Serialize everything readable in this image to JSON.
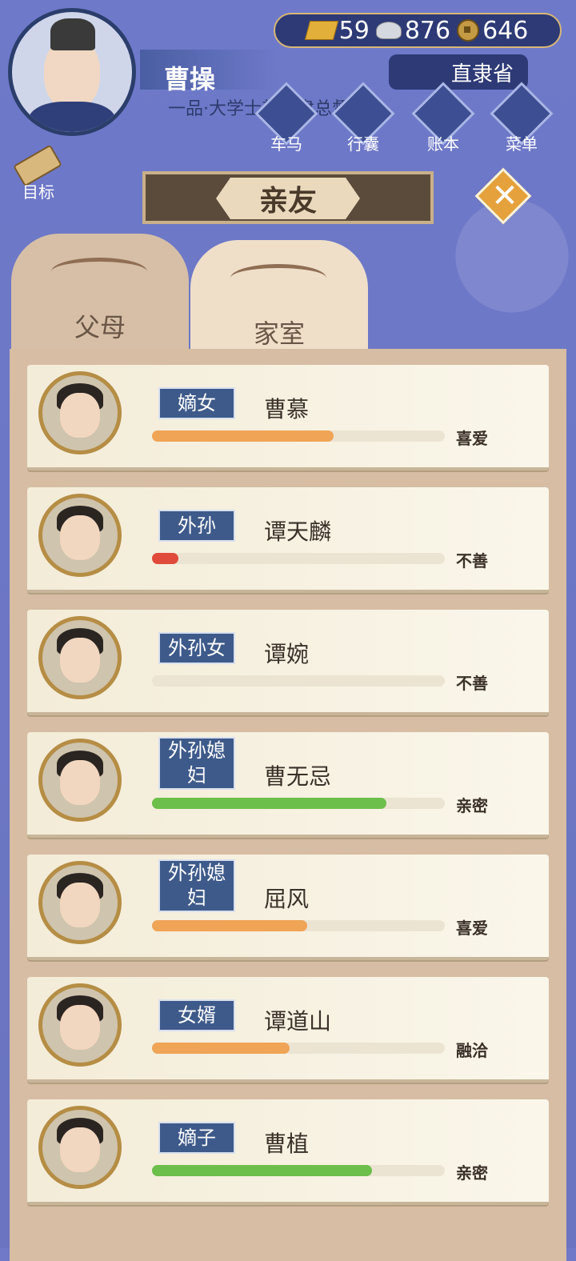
{
  "player": {
    "name": "曹操",
    "title": "一品·大学士兼直隶总督"
  },
  "currency": {
    "gold": "59",
    "silver": "876",
    "copper": "646"
  },
  "province": "直隶省",
  "menu": [
    {
      "label": "车马",
      "icon": "carriage-icon"
    },
    {
      "label": "行囊",
      "icon": "bag-icon"
    },
    {
      "label": "账本",
      "icon": "ledger-icon"
    },
    {
      "label": "菜单",
      "icon": "more-icon"
    }
  ],
  "goal_label": "目标",
  "header_title": "亲友",
  "tabs": [
    {
      "label": "父母",
      "active": false
    },
    {
      "label": "家室",
      "active": true
    }
  ],
  "relatives": [
    {
      "relation": "嫡女",
      "name": "曹慕",
      "attitude": "喜爱",
      "level": 0.62,
      "color": "#f0a456"
    },
    {
      "relation": "外孙",
      "name": "谭天麟",
      "attitude": "不善",
      "level": 0.09,
      "color": "#e04a3a"
    },
    {
      "relation": "外孙女",
      "name": "谭婉",
      "attitude": "不善",
      "level": 0.0,
      "color": "#e04a3a"
    },
    {
      "relation": "外孙媳妇",
      "name": "曹无忌",
      "attitude": "亲密",
      "level": 0.8,
      "color": "#6cbf4a"
    },
    {
      "relation": "外孙媳妇",
      "name": "屈风",
      "attitude": "喜爱",
      "level": 0.53,
      "color": "#f0a456"
    },
    {
      "relation": "女婿",
      "name": "谭道山",
      "attitude": "融洽",
      "level": 0.47,
      "color": "#f0a456"
    },
    {
      "relation": "嫡子",
      "name": "曹植",
      "attitude": "亲密",
      "level": 0.75,
      "color": "#6cbf4a"
    }
  ]
}
